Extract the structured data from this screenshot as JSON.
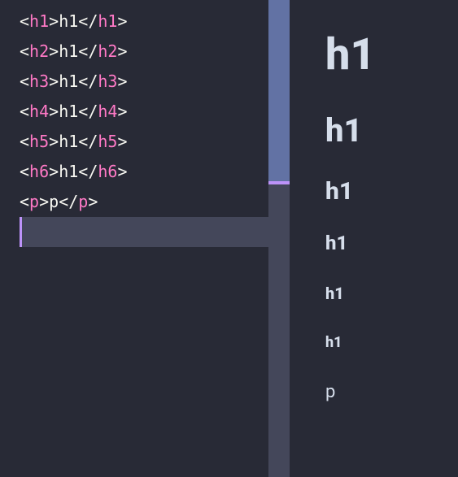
{
  "editor": {
    "lines": [
      {
        "tag": "h1",
        "text": "h1"
      },
      {
        "tag": "h2",
        "text": "h1"
      },
      {
        "tag": "h3",
        "text": "h1"
      },
      {
        "tag": "h4",
        "text": "h1"
      },
      {
        "tag": "h5",
        "text": "h1"
      },
      {
        "tag": "h6",
        "text": "h1"
      },
      {
        "tag": "p",
        "text": "p"
      }
    ],
    "punct": {
      "lt": "<",
      "gt": ">",
      "lts": "</"
    }
  },
  "scroll": {
    "thumb_top_pct": 0,
    "thumb_height_pct": 38,
    "mark_top_pct": 38
  },
  "preview": {
    "items": [
      {
        "cls": "h1",
        "text": "h1"
      },
      {
        "cls": "h2",
        "text": "h1"
      },
      {
        "cls": "h3",
        "text": "h1"
      },
      {
        "cls": "h4",
        "text": "h1"
      },
      {
        "cls": "h5",
        "text": "h1"
      },
      {
        "cls": "h6",
        "text": "h1"
      },
      {
        "cls": "p",
        "text": "p"
      }
    ]
  }
}
